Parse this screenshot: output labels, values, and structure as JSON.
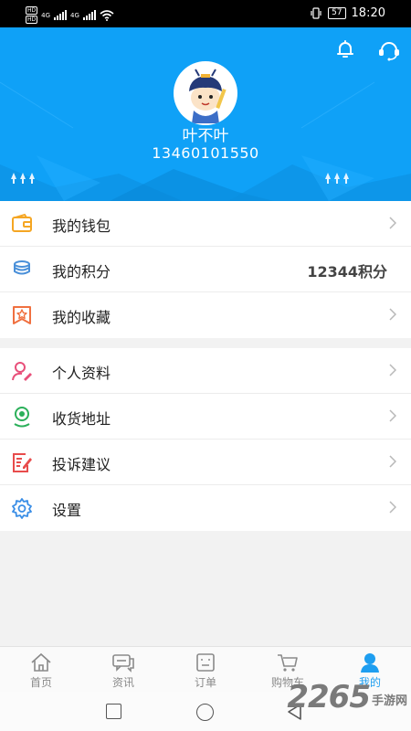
{
  "status_bar": {
    "sim1": "HD",
    "sim2": "HD",
    "net1": "4G",
    "net2": "4G",
    "battery": "57",
    "time": "18:20"
  },
  "profile": {
    "name": "叶不叶",
    "phone": "13460101550"
  },
  "menu_group_1": [
    {
      "label": "我的钱包",
      "icon": "wallet-icon",
      "color": "#f5a623"
    },
    {
      "label": "我的积分",
      "icon": "coins-icon",
      "color": "#4a90d9",
      "value": "12344积分"
    },
    {
      "label": "我的收藏",
      "icon": "favorite-star-icon",
      "color": "#f07040"
    }
  ],
  "menu_group_2": [
    {
      "label": "个人资料",
      "icon": "user-edit-icon",
      "color": "#e8507a"
    },
    {
      "label": "收货地址",
      "icon": "location-icon",
      "color": "#2bb05a"
    },
    {
      "label": "投诉建议",
      "icon": "feedback-edit-icon",
      "color": "#e84c4c"
    },
    {
      "label": "设置",
      "icon": "gear-icon",
      "color": "#3a8ee6"
    }
  ],
  "tabs": [
    {
      "label": "首页",
      "icon": "home-icon",
      "active": false
    },
    {
      "label": "资讯",
      "icon": "chat-icon",
      "active": false
    },
    {
      "label": "订单",
      "icon": "order-icon",
      "active": false
    },
    {
      "label": "购物车",
      "icon": "cart-icon",
      "active": false
    },
    {
      "label": "我的",
      "icon": "user-icon",
      "active": true
    }
  ],
  "colors": {
    "header_blue": "#0fa1f7",
    "tab_active": "#1e9ef0",
    "tab_inactive": "#8a8a8a"
  },
  "watermark": {
    "number": "2265",
    "text": "手游网"
  }
}
